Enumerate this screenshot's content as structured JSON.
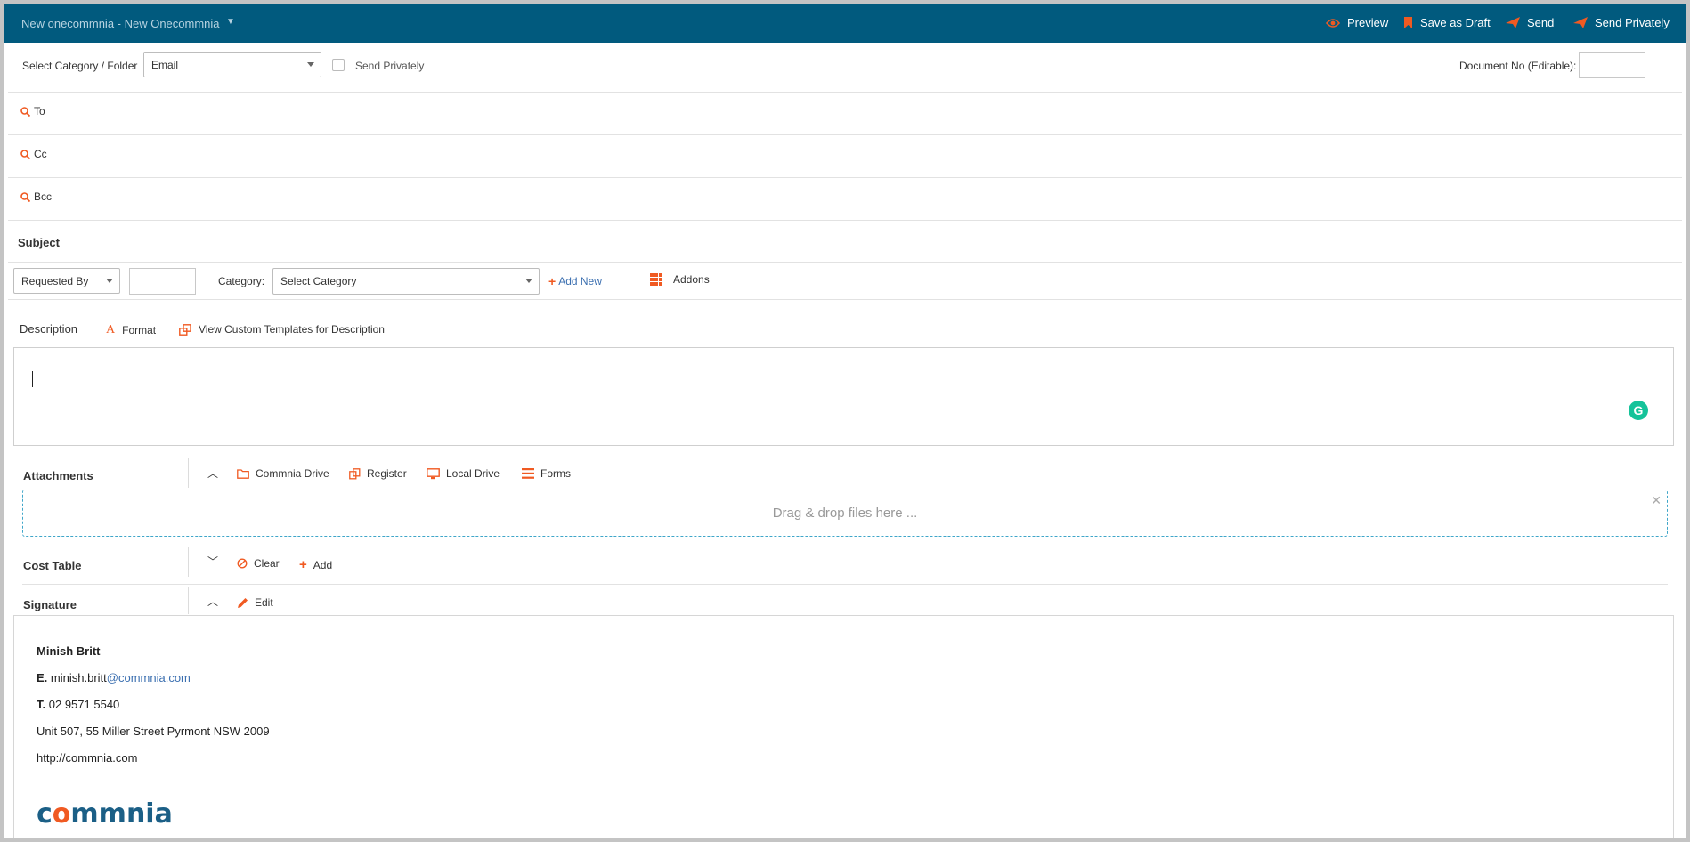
{
  "header": {
    "title": "New onecommnia - New Onecommnia",
    "actions": {
      "preview": "Preview",
      "save_draft": "Save as Draft",
      "send": "Send",
      "send_privately": "Send Privately"
    }
  },
  "form": {
    "category_label": "Select Category / Folder",
    "category_value": "Email",
    "send_privately_label": "Send Privately",
    "document_no_label": "Document No (Editable):",
    "to_label": "To",
    "cc_label": "Cc",
    "bcc_label": "Bcc",
    "subject_label": "Subject",
    "requested_by_value": "Requested By",
    "category_field_label": "Category:",
    "category_field_value": "Select Category",
    "add_new_label": "Add New",
    "addons_label": "Addons",
    "description_label": "Description",
    "format_label": "Format",
    "templates_label": "View Custom Templates for Description"
  },
  "attachments": {
    "label": "Attachments",
    "commnia_drive": "Commnia Drive",
    "register": "Register",
    "local_drive": "Local Drive",
    "forms": "Forms",
    "dropzone_text": "Drag & drop files here ..."
  },
  "cost_table": {
    "label": "Cost Table",
    "clear": "Clear",
    "add": "Add"
  },
  "signature": {
    "label": "Signature",
    "edit": "Edit",
    "name": "Minish Britt",
    "email_prefix": "E.",
    "email_user": "minish.britt",
    "email_domain": "@commnia.com",
    "phone_prefix": "T.",
    "phone": "02 9571 5540",
    "address": "Unit 507, 55 Miller Street Pyrmont NSW 2009",
    "website": "http://commnia.com",
    "logo_part1": "c",
    "logo_part2": "o",
    "logo_part3": "mmnia"
  },
  "colors": {
    "topbar": "#015a7e",
    "accent": "#f05a22",
    "link": "#3b6fb0"
  }
}
